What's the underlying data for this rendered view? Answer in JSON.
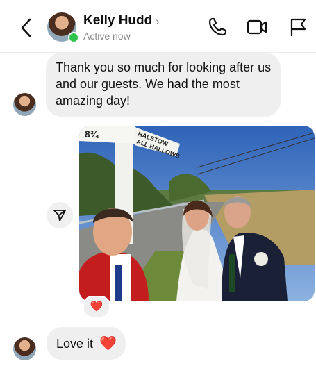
{
  "header": {
    "contact_name": "Kelly Hudd",
    "chevron": "›",
    "status": "Active now",
    "icons": [
      "back-arrow-icon",
      "phone-icon",
      "video-camera-icon",
      "flag-icon"
    ],
    "online_color": "#2ec24a"
  },
  "messages": [
    {
      "from": "contact",
      "text": "Thank you so much for looking after us and our guests. We had the most amazing day!"
    },
    {
      "from": "me",
      "type": "photo",
      "sign_text": [
        "8¾",
        "HALSTOW",
        "ALL HALLOWS"
      ],
      "reaction": "❤️"
    },
    {
      "from": "contact",
      "text": "Love it",
      "emoji": "❤️"
    }
  ],
  "colors": {
    "bubble": "#efefef",
    "reaction_heart": "#e0232e"
  }
}
